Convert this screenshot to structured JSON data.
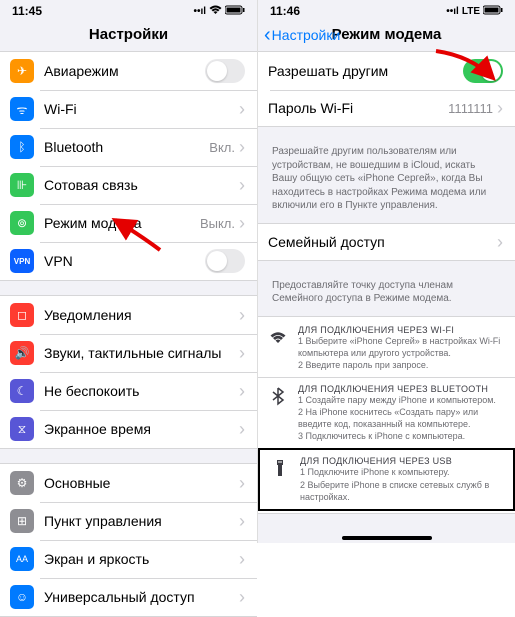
{
  "left": {
    "status": {
      "time": "11:45",
      "signal": "••␟",
      "net": "",
      "battery": "■□"
    },
    "title": "Настройки",
    "group1": [
      {
        "icon": "airplane",
        "color": "bg-orange",
        "label": "Авиарежим",
        "toggle": "off"
      },
      {
        "icon": "wifi",
        "color": "bg-blue",
        "label": "Wi-Fi",
        "value": " "
      },
      {
        "icon": "bluetooth",
        "color": "bg-blue",
        "label": "Bluetooth",
        "value": "Вкл."
      },
      {
        "icon": "antenna",
        "color": "bg-green",
        "label": "Сотовая связь",
        "value": ""
      },
      {
        "icon": "hotspot",
        "color": "bg-green",
        "label": "Режим модема",
        "value": "Выкл."
      },
      {
        "icon": "vpn",
        "color": "bg-darkblue",
        "label": "VPN",
        "toggle": "off"
      }
    ],
    "group2": [
      {
        "icon": "bell",
        "color": "bg-red",
        "label": "Уведомления"
      },
      {
        "icon": "sound",
        "color": "bg-red",
        "label": "Звуки, тактильные сигналы"
      },
      {
        "icon": "moon",
        "color": "bg-purple",
        "label": "Не беспокоить"
      },
      {
        "icon": "hourglass",
        "color": "bg-purple",
        "label": "Экранное время"
      }
    ],
    "group3": [
      {
        "icon": "gear",
        "color": "bg-gray",
        "label": "Основные"
      },
      {
        "icon": "sliders",
        "color": "bg-gray",
        "label": "Пункт управления"
      },
      {
        "icon": "display",
        "color": "bg-blue",
        "label": "Экран и яркость"
      },
      {
        "icon": "accessibility",
        "color": "bg-blue",
        "label": "Универсальный доступ"
      }
    ]
  },
  "right": {
    "status": {
      "time": "11:46",
      "signal": "••␟",
      "net": "LTE",
      "battery": "■"
    },
    "back": "Настройки",
    "title": "Режим модема",
    "allow": {
      "label": "Разрешать другим",
      "toggle": "on"
    },
    "password": {
      "label": "Пароль Wi-Fi",
      "value": "1111111"
    },
    "footer1": "Разрешайте другим пользователям или устройствам, не вошедшим в iCloud, искать Вашу общую сеть «iPhone Сергей», когда Вы находитесь в настройках Режима модема или включили его в Пункте управления.",
    "family": {
      "label": "Семейный доступ"
    },
    "footer2": "Предоставляйте точку доступа членам Семейного доступа в Режиме модема.",
    "conn_wifi": {
      "title": "ДЛЯ ПОДКЛЮЧЕНИЯ ЧЕРЕЗ WI-FI",
      "s1": "1 Выберите «iPhone Сергей» в настройках Wi-Fi компьютера или другого устройства.",
      "s2": "2 Введите пароль при запросе."
    },
    "conn_bt": {
      "title": "ДЛЯ ПОДКЛЮЧЕНИЯ ЧЕРЕЗ BLUETOOTH",
      "s1": "1 Создайте пару между iPhone и компьютером.",
      "s2": "2 На iPhone коснитесь «Создать пару» или введите код, показанный на компьютере.",
      "s3": "3 Подключитесь к iPhone с компьютера."
    },
    "conn_usb": {
      "title": "ДЛЯ ПОДКЛЮЧЕНИЯ ЧЕРЕЗ USB",
      "s1": "1 Подключите iPhone к компьютеру.",
      "s2": "2 Выберите iPhone в списке сетевых служб в настройках."
    }
  }
}
